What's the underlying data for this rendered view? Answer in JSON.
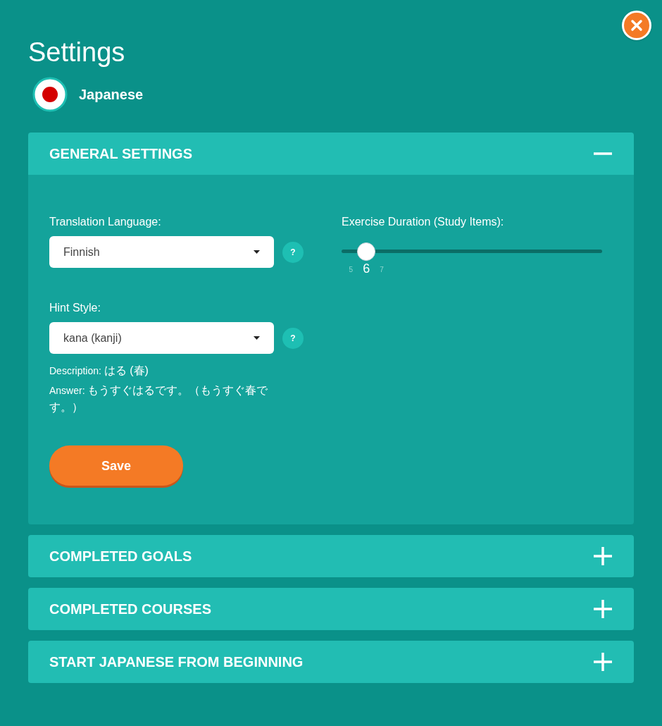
{
  "title": "Settings",
  "language": {
    "name": "Japanese"
  },
  "sections": [
    {
      "title": "GENERAL SETTINGS",
      "expanded": true
    },
    {
      "title": "COMPLETED GOALS",
      "expanded": false
    },
    {
      "title": "COMPLETED COURSES",
      "expanded": false
    },
    {
      "title": "START JAPANESE FROM BEGINNING",
      "expanded": false
    }
  ],
  "general": {
    "translation": {
      "label": "Translation Language:",
      "value": "Finnish",
      "help": "?"
    },
    "hint": {
      "label": "Hint Style:",
      "value": "kana (kanji)",
      "help": "?"
    },
    "description": {
      "label": "Description:",
      "value": "はる (春)"
    },
    "answer": {
      "label": "Answer:",
      "value": "もうすぐはるです。（もうすぐ春です。）"
    },
    "duration": {
      "label": "Exercise Duration (Study Items):",
      "level": 0.095,
      "prev": "5",
      "current": "6",
      "next": "7"
    },
    "save": "Save"
  }
}
